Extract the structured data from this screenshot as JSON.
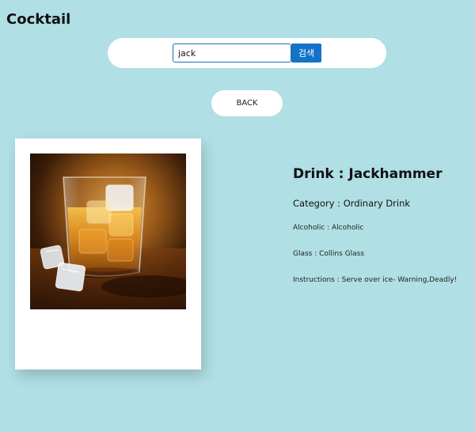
{
  "header": {
    "title": "Cocktail"
  },
  "search": {
    "value": "jack",
    "button_label": "검색"
  },
  "back_button_label": "BACK",
  "drink": {
    "name_line": "Drink : Jackhammer",
    "category_line": "Category : Ordinary Drink",
    "alcoholic_line": "Alcoholic : Alcoholic",
    "glass_line": "Glass : Collins Glass",
    "instructions_line": "Instructions : Serve over ice- Warning,Deadly!",
    "image_icon": "whiskey-glass-with-ice"
  },
  "colors": {
    "background": "#b0dfe5",
    "button_blue": "#1473c8",
    "input_border": "#1a6fb8"
  }
}
